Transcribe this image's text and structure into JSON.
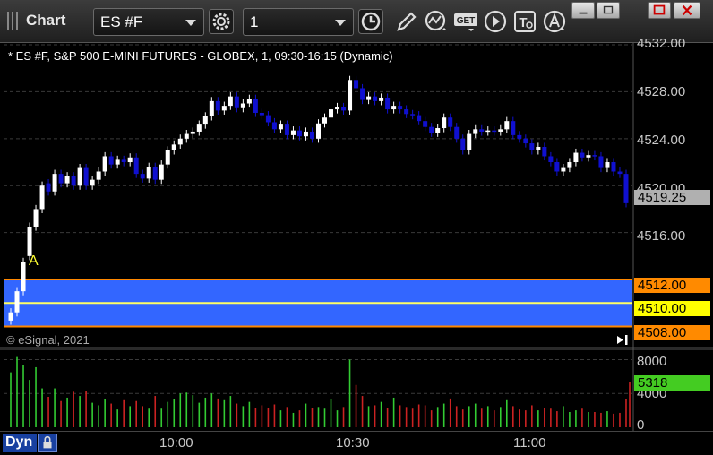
{
  "window": {
    "title": "Chart",
    "minimize_icon": "minimize-icon",
    "restore_icon": "restore-icon",
    "maximize_icon": "maximize-icon",
    "close_icon": "close-icon"
  },
  "toolbar": {
    "symbol": "ES #F",
    "interval": "1",
    "button_labels": {
      "get": "GET",
      "text": "T"
    }
  },
  "chart_header": "* ES #F, S&P 500 E-MINI FUTURES - GLOBEX, 1, 09:30-16:15 (Dynamic)",
  "alert_marker": "A",
  "copyright": "© eSignal, 2021",
  "price_axis": {
    "ticks": [
      "4532.00",
      "4528.00",
      "4524.00",
      "4520.00",
      "4516.00"
    ],
    "last_price": "4519.25",
    "level_upper": "4512.00",
    "level_mid": "4510.00",
    "level_lower": "4508.00"
  },
  "volume_axis": {
    "ticks": [
      "8000",
      "4000",
      "0"
    ],
    "last_volume": "5318"
  },
  "time_axis": {
    "mode": "Dyn",
    "ticks": [
      "10:00",
      "10:30",
      "11:00"
    ]
  },
  "colors": {
    "up_candle": "#ffffff",
    "down_candle": "#1010d0",
    "zone_fill": "#3366ff",
    "zone_border": "#ff8800",
    "mid_line": "#ffff66",
    "vol_up": "#33cc33",
    "vol_down": "#cc2222"
  },
  "chart_data": {
    "type": "candlestick",
    "title": "ES #F, S&P 500 E-MINI FUTURES - GLOBEX, 1, 09:30-16:15 (Dynamic)",
    "ylim": [
      4507.5,
      4532.0
    ],
    "volume_ylim": [
      0,
      9000
    ],
    "x_ticks": [
      "10:00",
      "10:30",
      "11:00"
    ],
    "closes": [
      4509.2,
      4511.0,
      4513.5,
      4516.5,
      4518.0,
      4520.0,
      4519.5,
      4521.0,
      4520.2,
      4520.8,
      4520.0,
      4521.5,
      4520.0,
      4520.5,
      4521.2,
      4522.5,
      4521.8,
      4522.2,
      4522.0,
      4522.4,
      4521.0,
      4520.6,
      4521.6,
      4520.5,
      4521.8,
      4523.0,
      4523.5,
      4524.0,
      4524.4,
      4524.6,
      4525.2,
      4525.9,
      4527.2,
      4526.4,
      4526.8,
      4527.6,
      4526.6,
      4527.0,
      4527.4,
      4526.2,
      4526.0,
      4525.4,
      4524.8,
      4525.2,
      4524.3,
      4524.7,
      4524.2,
      4524.6,
      4524.0,
      4525.3,
      4525.8,
      4526.5,
      4526.7,
      4526.4,
      4529.0,
      4528.3,
      4527.3,
      4527.6,
      4527.2,
      4527.5,
      4526.5,
      4526.8,
      4526.5,
      4526.1,
      4526.0,
      4525.5,
      4525.0,
      4524.5,
      4524.9,
      4525.8,
      4525.0,
      4524.0,
      4523.0,
      4524.4,
      4524.8,
      4524.6,
      4524.7,
      4524.6,
      4524.8,
      4525.5,
      4524.3,
      4524.0,
      4523.6,
      4523.0,
      4523.3,
      4522.5,
      4522.0,
      4521.2,
      4521.5,
      4522.0,
      4522.8,
      4522.4,
      4522.6,
      4522.5,
      4521.5,
      4522.0,
      4521.2,
      4521.0,
      4518.5
    ],
    "opens": [
      4508.5,
      4509.2,
      4511.0,
      4514.0,
      4516.5,
      4518.0,
      4520.2,
      4519.5,
      4521.0,
      4520.2,
      4520.8,
      4520.0,
      4521.5,
      4520.0,
      4520.5,
      4521.2,
      4522.5,
      4521.8,
      4522.2,
      4522.0,
      4522.4,
      4521.0,
      4520.6,
      4521.6,
      4520.5,
      4521.8,
      4523.0,
      4523.5,
      4524.0,
      4524.4,
      4524.6,
      4525.2,
      4525.9,
      4527.2,
      4526.4,
      4526.8,
      4527.6,
      4526.6,
      4527.0,
      4527.4,
      4526.2,
      4526.0,
      4525.4,
      4524.8,
      4525.2,
      4524.3,
      4524.7,
      4524.2,
      4524.6,
      4524.0,
      4525.3,
      4525.8,
      4526.5,
      4526.7,
      4526.4,
      4529.0,
      4528.3,
      4527.3,
      4527.6,
      4527.2,
      4527.5,
      4526.5,
      4526.8,
      4526.5,
      4526.1,
      4526.0,
      4525.5,
      4525.0,
      4524.5,
      4524.9,
      4525.8,
      4525.0,
      4524.0,
      4523.0,
      4524.4,
      4524.8,
      4524.6,
      4524.7,
      4524.6,
      4524.8,
      4525.5,
      4524.3,
      4524.0,
      4523.6,
      4523.0,
      4523.3,
      4522.5,
      4522.0,
      4521.2,
      4521.5,
      4522.0,
      4522.8,
      4522.4,
      4522.6,
      4522.5,
      4521.5,
      4522.0,
      4521.2,
      4521.0
    ],
    "volume": [
      6500,
      8300,
      7400,
      5600,
      7100,
      4600,
      3600,
      4600,
      3100,
      3500,
      4200,
      3700,
      4300,
      2900,
      2600,
      3300,
      2800,
      2100,
      3200,
      2500,
      3100,
      2500,
      2200,
      3700,
      2200,
      3000,
      3300,
      4000,
      4100,
      3800,
      2900,
      3500,
      4000,
      3400,
      3200,
      3700,
      2800,
      2500,
      3000,
      2300,
      2600,
      2300,
      2700,
      2000,
      2400,
      1700,
      2000,
      2800,
      2300,
      2400,
      2200,
      3300,
      2000,
      2400,
      8000,
      5000,
      3700,
      2500,
      2600,
      3000,
      2300,
      3500,
      2600,
      2400,
      2200,
      2700,
      2600,
      2000,
      2400,
      2800,
      3400,
      2500,
      2100,
      2500,
      2800,
      2200,
      2500,
      2000,
      2400,
      3200,
      2500,
      2100,
      2000,
      2600,
      2000,
      2300,
      2200,
      1900,
      2500,
      1800,
      2000,
      2200,
      1800,
      1800,
      1700,
      1900,
      1600,
      1700,
      3300,
      5318
    ]
  }
}
